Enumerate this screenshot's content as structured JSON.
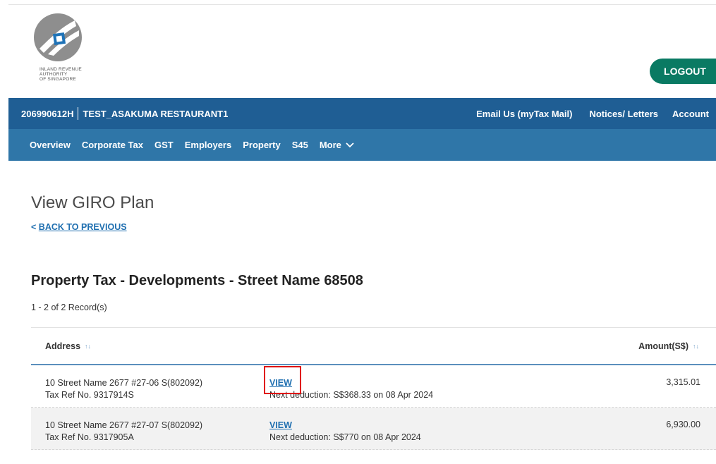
{
  "brand": {
    "logo_lines": [
      "INLAND REVENUE",
      "AUTHORITY",
      "OF SINGAPORE"
    ],
    "logo_icon": "iras-logo-icon"
  },
  "header": {
    "logout_label": "LOGOUT"
  },
  "account_bar": {
    "id": "206990612H",
    "name": "TEST_ASAKUMA RESTAURANT1",
    "links": [
      "Email Us (myTax Mail)",
      "Notices/ Letters",
      "Account"
    ]
  },
  "main_nav": {
    "tabs": [
      "Overview",
      "Corporate Tax",
      "GST",
      "Employers",
      "Property",
      "S45"
    ],
    "more_label": "More",
    "more_icon": "chevron-down-icon"
  },
  "page": {
    "title": "View GIRO Plan",
    "back_label": "BACK TO PREVIOUS",
    "back_icon": "<"
  },
  "section": {
    "title": "Property Tax - Developments - Street Name 68508",
    "record_count": "1 - 2 of 2 Record(s)"
  },
  "table": {
    "columns": {
      "address": "Address",
      "amount": "Amount(S$)",
      "sort_icon": "↑↓"
    },
    "rows": [
      {
        "address": "10 Street Name 2677 #27-06 S(802092)",
        "tax_ref": "Tax Ref No. 9317914S",
        "view_label": "VIEW",
        "next_deduction": "Next deduction: S$368.33 on 08 Apr 2024",
        "amount": "3,315.01"
      },
      {
        "address": "10 Street Name 2677 #27-07 S(802092)",
        "tax_ref": "Tax Ref No. 9317905A",
        "view_label": "VIEW",
        "next_deduction": "Next deduction: S$770 on 08 Apr 2024",
        "amount": "6,930.00"
      }
    ]
  },
  "colors": {
    "nav_top": "#1f5e94",
    "nav_sub": "#2f76a8",
    "logout": "#0a7a63",
    "link": "#1f6fb0",
    "highlight": "#e00000"
  }
}
